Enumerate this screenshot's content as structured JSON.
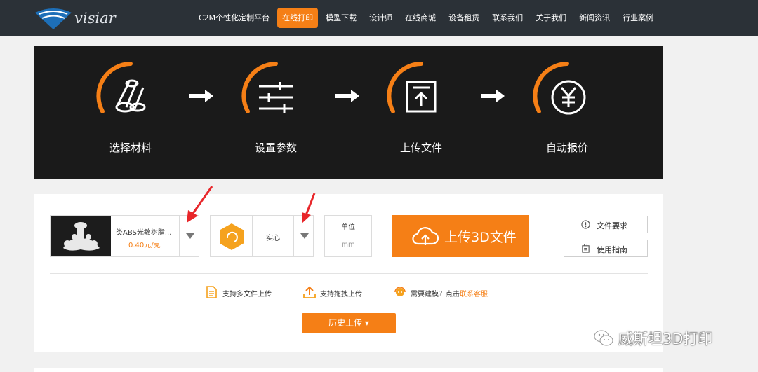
{
  "brand": {
    "logo_text": "visiar"
  },
  "nav": {
    "items": [
      {
        "label": "C2M个性化定制平台"
      },
      {
        "label": "在线打印"
      },
      {
        "label": "模型下载"
      },
      {
        "label": "设计师"
      },
      {
        "label": "在线商城"
      },
      {
        "label": "设备租赁"
      },
      {
        "label": "联系我们"
      },
      {
        "label": "关于我们"
      },
      {
        "label": "新闻资讯"
      },
      {
        "label": "行业案例"
      }
    ],
    "active_index": 1
  },
  "steps": [
    {
      "label": "选择材料",
      "icon": "materials-icon"
    },
    {
      "label": "设置参数",
      "icon": "sliders-icon"
    },
    {
      "label": "上传文件",
      "icon": "upload-file-icon"
    },
    {
      "label": "自动报价",
      "icon": "yen-icon"
    }
  ],
  "material": {
    "name": "类ABS光敏树脂...",
    "price": "0.40元/克"
  },
  "fill": {
    "value": "实心"
  },
  "unit": {
    "title": "单位",
    "value": "mm"
  },
  "upload": {
    "label": "上传3D文件"
  },
  "side_buttons": {
    "requirements": "文件要求",
    "guide": "使用指南"
  },
  "features": {
    "multi": "支持多文件上传",
    "drag": "支持拖拽上传",
    "modeling_prefix": "需要建模？点击",
    "modeling_link": "联系客服"
  },
  "history": {
    "label": "历史上传 ▾"
  },
  "watermark": {
    "text": "威斯坦3D打印"
  },
  "colors": {
    "accent": "#f57f16",
    "nav_bg": "#2b3137",
    "banner_bg": "#1a1a1a",
    "annotation_red": "#e8262a"
  }
}
